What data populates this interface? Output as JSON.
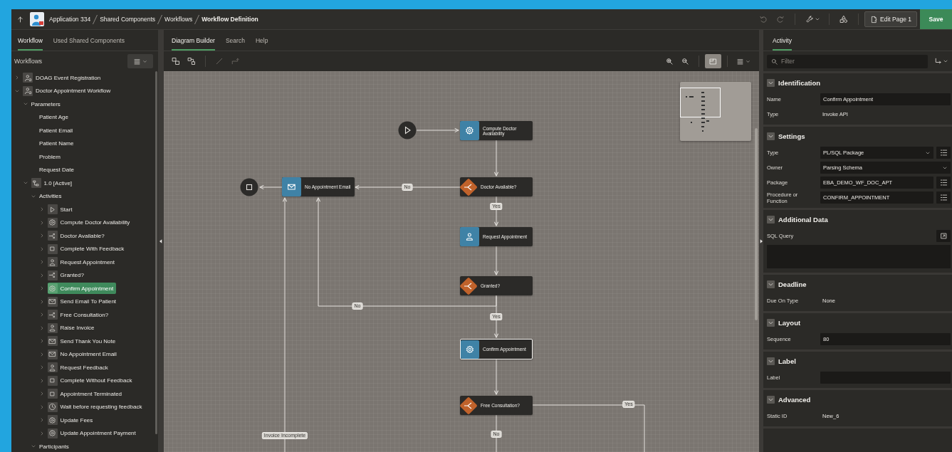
{
  "top_bar": {
    "breadcrumbs": [
      {
        "label": "Application 334",
        "current": false
      },
      {
        "label": "Shared Components",
        "current": false
      },
      {
        "label": "Workflows",
        "current": false
      },
      {
        "label": "Workflow Definition",
        "current": true
      }
    ],
    "undo": {
      "disabled": true
    },
    "redo": {
      "disabled": true
    },
    "edit_button": "Edit Page 1",
    "save_button": "Save"
  },
  "left_panel": {
    "tabs": [
      {
        "label": "Workflow",
        "selected": true
      },
      {
        "label": "Used Shared Components",
        "selected": false
      }
    ],
    "heading": "Workflows",
    "tree": [
      {
        "label": "DOAG Event Registration",
        "kind": "workflow",
        "expanded": false,
        "selected": false
      },
      {
        "label": "Doctor Appointment Workflow",
        "kind": "workflow",
        "expanded": true,
        "selected": false,
        "children": [
          {
            "label": "Parameters",
            "expanded": true,
            "selected": false,
            "children": [
              {
                "label": "Patient Age",
                "selected": false
              },
              {
                "label": "Patient Email",
                "selected": false
              },
              {
                "label": "Patient Name",
                "selected": false
              },
              {
                "label": "Problem",
                "selected": false
              },
              {
                "label": "Request Date",
                "selected": false
              }
            ]
          },
          {
            "label": "1.0 [Active]",
            "kind": "version",
            "expanded": true,
            "selected": false,
            "children": [
              {
                "label": "Activities",
                "expanded": true,
                "selected": false,
                "children": [
                  {
                    "label": "Start",
                    "kind": "start",
                    "expanded": false,
                    "selected": false
                  },
                  {
                    "label": "Compute Doctor Availability",
                    "kind": "api",
                    "expanded": false,
                    "selected": false
                  },
                  {
                    "label": "Doctor Available?",
                    "kind": "switch",
                    "expanded": false,
                    "selected": false
                  },
                  {
                    "label": "Complete With Feedback",
                    "kind": "end",
                    "expanded": false,
                    "selected": false
                  },
                  {
                    "label": "Request Appointment",
                    "kind": "human",
                    "expanded": false,
                    "selected": false
                  },
                  {
                    "label": "Granted?",
                    "kind": "switch",
                    "expanded": false,
                    "selected": false
                  },
                  {
                    "label": "Confirm Appointment",
                    "kind": "api",
                    "expanded": false,
                    "selected": true
                  },
                  {
                    "label": "Send Email To Patient",
                    "kind": "email",
                    "expanded": false,
                    "selected": false
                  },
                  {
                    "label": "Free Consultation?",
                    "kind": "switch",
                    "expanded": false,
                    "selected": false
                  },
                  {
                    "label": "Raise Invoice",
                    "kind": "human",
                    "expanded": false,
                    "selected": false
                  },
                  {
                    "label": "Send Thank You Note",
                    "kind": "email",
                    "expanded": false,
                    "selected": false
                  },
                  {
                    "label": "No Appointment Email",
                    "kind": "email",
                    "expanded": false,
                    "selected": false
                  },
                  {
                    "label": "Request Feedback",
                    "kind": "human",
                    "expanded": false,
                    "selected": false
                  },
                  {
                    "label": "Complete Without Feedback",
                    "kind": "end",
                    "expanded": false,
                    "selected": false
                  },
                  {
                    "label": "Appointment Terminated",
                    "kind": "end",
                    "expanded": false,
                    "selected": false
                  },
                  {
                    "label": "Wait before requesting feedback",
                    "kind": "wait",
                    "expanded": false,
                    "selected": false
                  },
                  {
                    "label": "Update Fees",
                    "kind": "api",
                    "expanded": false,
                    "selected": false
                  },
                  {
                    "label": "Update Appointment Payment",
                    "kind": "api",
                    "expanded": false,
                    "selected": false
                  }
                ]
              },
              {
                "label": "Participants",
                "expanded": true,
                "selected": false
              }
            ]
          }
        ]
      }
    ]
  },
  "center": {
    "tabs": [
      {
        "label": "Diagram Builder",
        "selected": true
      },
      {
        "label": "Search",
        "selected": false
      },
      {
        "label": "Help",
        "selected": false
      }
    ],
    "toolbar": {
      "connectors_disabled": true,
      "minimap_on": true
    },
    "diagram": {
      "nodes": [
        {
          "kind": "start",
          "selected": false
        },
        {
          "kind": "api",
          "label": "Compute Doctor Availability",
          "selected": false
        },
        {
          "kind": "end",
          "selected": false
        },
        {
          "kind": "email",
          "label": "No Appointment Email",
          "selected": false
        },
        {
          "kind": "switch",
          "label": "Doctor Available?",
          "selected": false
        },
        {
          "kind": "human",
          "label": "Request Appointment",
          "selected": false
        },
        {
          "kind": "switch",
          "label": "Granted?",
          "selected": false
        },
        {
          "kind": "api",
          "label": "Confirm Appointment",
          "selected": true
        },
        {
          "kind": "switch",
          "label": "Free Consultation?",
          "selected": false
        }
      ],
      "connector_labels": [
        "No",
        "Yes",
        "No",
        "Yes",
        "Yes",
        "Invoice Incomplete",
        "No"
      ]
    }
  },
  "right_panel": {
    "tabs": [
      {
        "label": "Activity",
        "selected": true
      }
    ],
    "filter": {
      "placeholder": "Filter"
    },
    "sections": [
      {
        "title": "Identification",
        "expanded": true,
        "fields": [
          {
            "label": "Name",
            "kind": "input",
            "value": "Confirm Appointment",
            "lov": false
          },
          {
            "label": "Type",
            "kind": "text",
            "value": "Invoke API"
          }
        ]
      },
      {
        "title": "Settings",
        "expanded": true,
        "fields": [
          {
            "label": "Type",
            "kind": "select",
            "value": "PL/SQL Package",
            "lov": true
          },
          {
            "label": "Owner",
            "kind": "select",
            "value": "Parsing Schema",
            "lov": false
          },
          {
            "label": "Package",
            "kind": "input",
            "value": "EBA_DEMO_WF_DOC_APT",
            "lov": true
          },
          {
            "label": "Procedure or Function",
            "kind": "input",
            "value": "CONFIRM_APPOINTMENT",
            "lov": true
          }
        ]
      },
      {
        "title": "Additional Data",
        "expanded": true,
        "fields": [
          {
            "label": "SQL Query",
            "kind": "code"
          }
        ]
      },
      {
        "title": "Deadline",
        "expanded": true,
        "fields": [
          {
            "label": "Due On Type",
            "kind": "text",
            "value": "None"
          }
        ]
      },
      {
        "title": "Layout",
        "expanded": true,
        "fields": [
          {
            "label": "Sequence",
            "kind": "input",
            "value": "80",
            "lov": false
          }
        ]
      },
      {
        "title": "Label",
        "expanded": true,
        "fields": [
          {
            "label": "Label",
            "kind": "input",
            "lov": false
          }
        ]
      },
      {
        "title": "Advanced",
        "expanded": true,
        "fields": [
          {
            "label": "Static ID",
            "kind": "text",
            "value": "New_6"
          }
        ]
      }
    ]
  }
}
